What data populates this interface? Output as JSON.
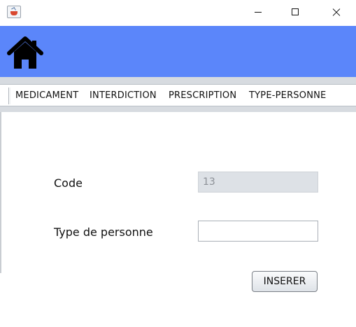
{
  "window": {
    "icon": "java-cup-icon",
    "controls": [
      "minimize-icon",
      "maximize-icon",
      "close-icon"
    ]
  },
  "header": {
    "icon": "home-icon",
    "background": "#5b86fa"
  },
  "nav": {
    "items": [
      {
        "label": "MEDICAMENT"
      },
      {
        "label": "INTERDICTION"
      },
      {
        "label": "PRESCRIPTION"
      },
      {
        "label": "TYPE-PERSONNE"
      }
    ]
  },
  "form": {
    "code_label": "Code",
    "code_value": "13",
    "type_label": "Type de personne",
    "type_value": "",
    "submit_label": "INSERER"
  }
}
